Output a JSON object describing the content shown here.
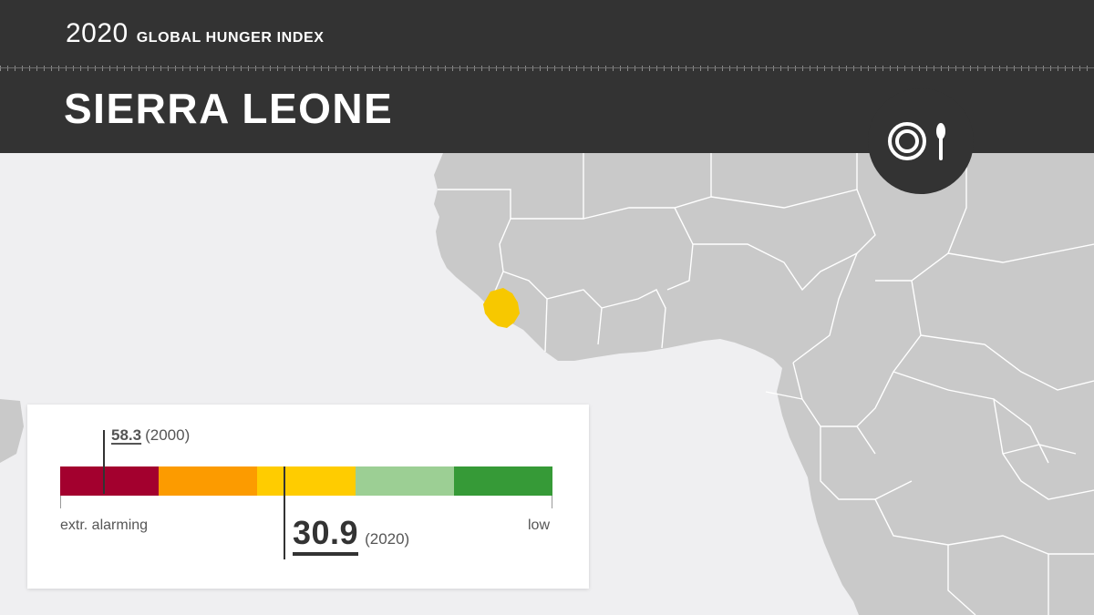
{
  "header": {
    "year": "2020",
    "report_title": "GLOBAL HUNGER INDEX",
    "country": "SIERRA LEONE",
    "icon": "plate-and-spoon-icon"
  },
  "map": {
    "highlighted_country": "Sierra Leone",
    "highlight_color": "#f7c800",
    "land_color": "#c9c9c9",
    "water_color": "#efeff1",
    "border_color": "#ffffff"
  },
  "score_card": {
    "scale_colors": [
      "#a3002e",
      "#fc9b00",
      "#ffcc00",
      "#9ccf94",
      "#369a37"
    ],
    "scale_start": 60,
    "scale_end": 0,
    "score_2000": {
      "value": "58.3",
      "year": "(2000)"
    },
    "score_2020": {
      "value": "30.9",
      "year": "(2020)"
    },
    "left_label": "extr. alarming",
    "right_label": "low"
  },
  "colors": {
    "header_bg": "#333333",
    "header_text": "#ffffff",
    "card_bg": "#ffffff"
  }
}
